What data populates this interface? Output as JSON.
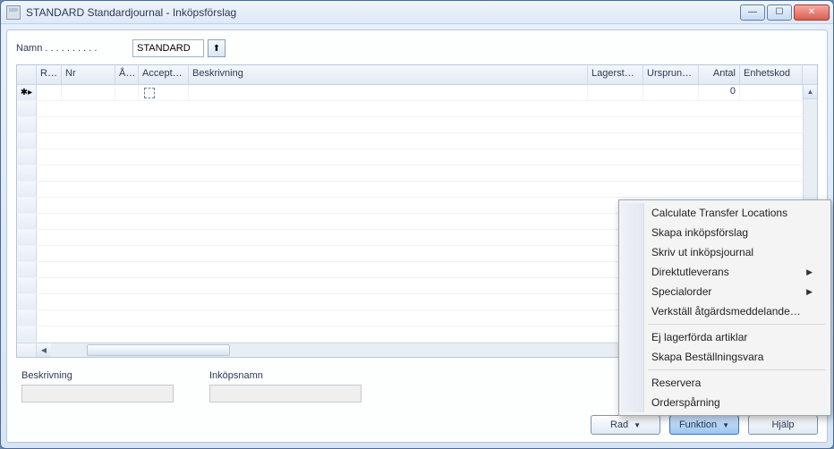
{
  "window": {
    "title": "STANDARD Standardjournal - Inköpsförslag"
  },
  "form": {
    "namn_label": "Namn . . . . . . . . . .",
    "namn_value": "STANDARD"
  },
  "grid": {
    "columns": {
      "r": "R…",
      "nr": "Nr",
      "a": "Å…",
      "acc": "Accepter…",
      "besk": "Beskrivning",
      "lag": "Lagerställ…",
      "urs": "Ursprungl…",
      "antal": "Antal",
      "en": "Enhetskod"
    },
    "rows": [
      {
        "antal": "0"
      }
    ],
    "row_marker": "✱▸"
  },
  "bottom": {
    "beskrivning_label": "Beskrivning",
    "inkopsnamn_label": "Inköpsnamn"
  },
  "buttons": {
    "rad": "Rad",
    "funktion": "Funktion",
    "hjalp": "Hjälp"
  },
  "menu": {
    "items": [
      {
        "label": "Calculate Transfer Locations",
        "submenu": false
      },
      {
        "label": "Skapa inköpsförslag",
        "submenu": false
      },
      {
        "label": "Skriv ut inköpsjournal",
        "submenu": false
      },
      {
        "label": "Direktutleverans",
        "submenu": true
      },
      {
        "label": "Specialorder",
        "submenu": true
      },
      {
        "label": "Verkställ åtgärdsmeddelande…",
        "submenu": false
      },
      {
        "sep": true
      },
      {
        "label": "Ej lagerförda artiklar",
        "submenu": false
      },
      {
        "label": "Skapa Beställningsvara",
        "submenu": false
      },
      {
        "sep": true
      },
      {
        "label": "Reservera",
        "submenu": false
      },
      {
        "label": "Orderspårning",
        "submenu": false
      }
    ]
  }
}
